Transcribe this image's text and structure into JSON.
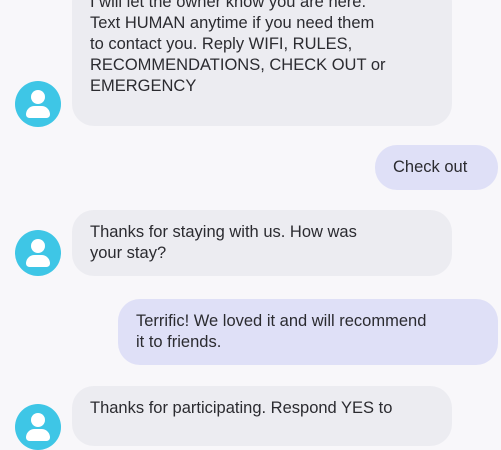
{
  "messages": [
    {
      "direction": "incoming",
      "lines": [
        "I will let the owner know you are here.",
        "Text HUMAN anytime if you need them",
        "to contact you. Reply WIFI, RULES,",
        "RECOMMENDATIONS, CHECK OUT or",
        "EMERGENCY"
      ]
    },
    {
      "direction": "outgoing",
      "lines": [
        "Check out"
      ]
    },
    {
      "direction": "incoming",
      "lines": [
        "Thanks for staying with us. How was",
        "your stay?"
      ]
    },
    {
      "direction": "outgoing",
      "lines": [
        "Terrific!  We loved it and will recommend",
        "it to friends."
      ]
    },
    {
      "direction": "incoming",
      "lines": [
        "Thanks for participating. Respond YES to"
      ]
    }
  ],
  "colors": {
    "background": "#f8f7fa",
    "incoming_bubble": "#ececf1",
    "outgoing_bubble": "#dfe0f7",
    "avatar": "#3ec6e6",
    "text": "#2b2b30"
  },
  "icons": {
    "avatar": "person-icon"
  }
}
